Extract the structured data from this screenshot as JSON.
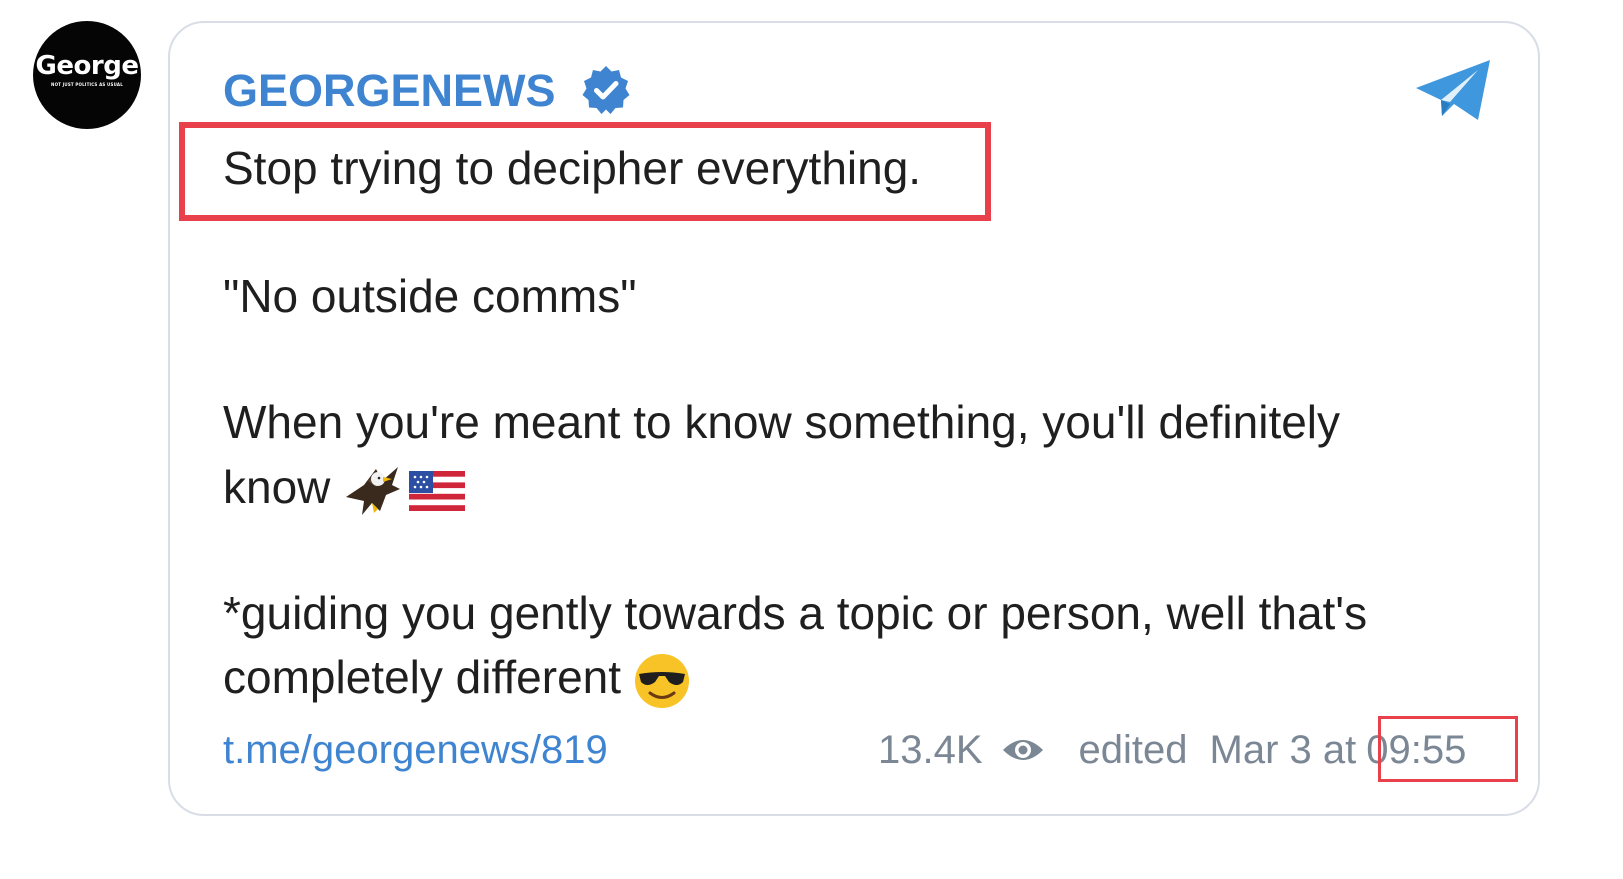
{
  "avatar": {
    "name": "George",
    "tagline": "NOT JUST POLITICS AS USUAL",
    "background": "#050505"
  },
  "post": {
    "channel_name": "GEORGENEWS",
    "channel_color": "#3f84d0",
    "verified_icon": "verified-badge-icon",
    "app_icon": "telegram-icon",
    "lines": [
      "Stop trying to decipher everything.",
      "\"No outside comms\"",
      "When you're meant to know something, you'll definitely",
      "know",
      "*guiding you gently towards a topic or person, well that's",
      "completely different"
    ],
    "line4_emojis": [
      "eagle-emoji",
      "us-flag-emoji"
    ],
    "line6_emoji": "sunglasses-emoji",
    "link": "t.me/georgenews/819",
    "views": "13.4K",
    "views_icon": "eye-icon",
    "edited_label": "edited",
    "date": "Mar 3 at",
    "time": "09:55",
    "highlight_color": "#e8414b"
  }
}
